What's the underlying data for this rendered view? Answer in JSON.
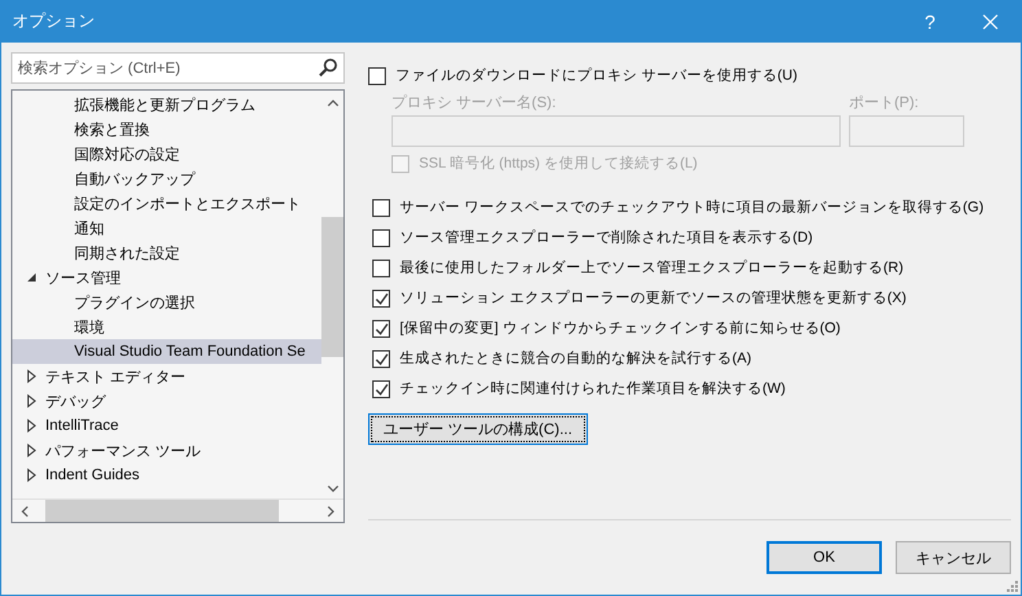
{
  "window": {
    "title": "オプション",
    "help": "?"
  },
  "search": {
    "placeholder": "検索オプション (Ctrl+E)"
  },
  "tree": {
    "items": [
      {
        "kind": "continued",
        "children": [
          {
            "label": "拡張機能と更新プログラム",
            "selected": false
          },
          {
            "label": "検索と置換",
            "selected": false
          },
          {
            "label": "国際対応の設定",
            "selected": false
          },
          {
            "label": "自動バックアップ",
            "selected": false
          },
          {
            "label": "設定のインポートとエクスポート",
            "selected": false
          },
          {
            "label": "通知",
            "selected": false
          },
          {
            "label": "同期された設定",
            "selected": false
          }
        ]
      },
      {
        "kind": "group",
        "label": "ソース管理",
        "expanded": true,
        "selected": false,
        "children": [
          {
            "label": "プラグインの選択",
            "selected": false
          },
          {
            "label": "環境",
            "selected": false
          },
          {
            "label": "Visual Studio Team Foundation Se",
            "selected": true
          }
        ]
      },
      {
        "kind": "group",
        "label": "テキスト エディター",
        "expanded": false,
        "selected": false
      },
      {
        "kind": "group",
        "label": "デバッグ",
        "expanded": false,
        "selected": false
      },
      {
        "kind": "group",
        "label": "IntelliTrace",
        "expanded": false,
        "selected": false
      },
      {
        "kind": "group",
        "label": "パフォーマンス ツール",
        "expanded": false,
        "selected": false
      },
      {
        "kind": "group",
        "label": "Indent Guides",
        "expanded": false,
        "selected": false
      }
    ]
  },
  "proxy": {
    "use_proxy": {
      "label": "ファイルのダウンロードにプロキシ サーバーを使用する(U)",
      "checked": false
    },
    "server_label": "プロキシ サーバー名(S):",
    "port_label": "ポート(P):",
    "disabled": true,
    "ssl": {
      "label": "SSL 暗号化 (https) を使用して接続する(L)",
      "checked": false
    }
  },
  "options": [
    {
      "label": "サーバー ワークスペースでのチェックアウト時に項目の最新バージョンを取得する(G)",
      "checked": false
    },
    {
      "label": "ソース管理エクスプローラーで削除された項目を表示する(D)",
      "checked": false
    },
    {
      "label": "最後に使用したフォルダー上でソース管理エクスプローラーを起動する(R)",
      "checked": false
    },
    {
      "label": "ソリューション エクスプローラーの更新でソースの管理状態を更新する(X)",
      "checked": true
    },
    {
      "label": "[保留中の変更] ウィンドウからチェックインする前に知らせる(O)",
      "checked": true
    },
    {
      "label": "生成されたときに競合の自動的な解決を試行する(A)",
      "checked": true
    },
    {
      "label": "チェックイン時に関連付けられた作業項目を解決する(W)",
      "checked": true
    }
  ],
  "configure_button": "ユーザー ツールの構成(C)...",
  "buttons": [
    {
      "label": "OK",
      "default": true
    },
    {
      "label": "キャンセル",
      "default": false
    }
  ]
}
